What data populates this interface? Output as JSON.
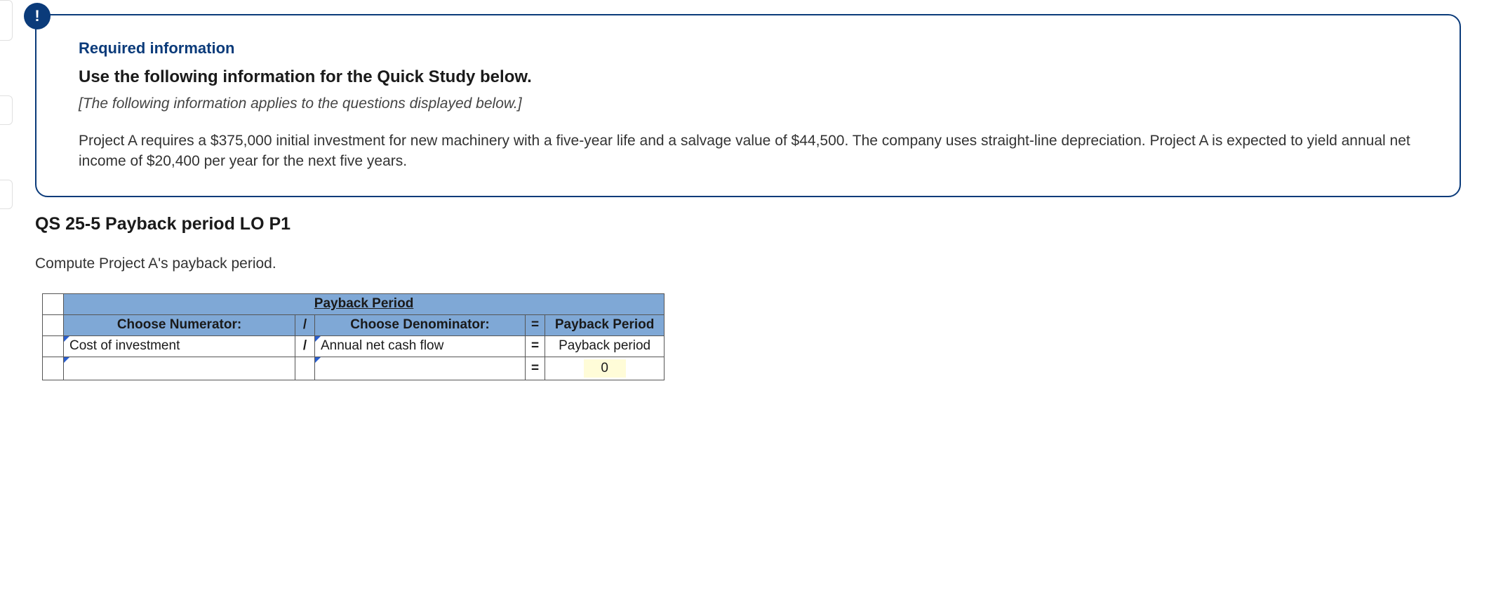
{
  "badge_char": "!",
  "info": {
    "required_header": "Required information",
    "use_heading": "Use the following information for the Quick Study below.",
    "italic_note": "[The following information applies to the questions displayed below.]",
    "prose": "Project A requires a $375,000 initial investment for new machinery with a five-year life and a salvage value of $44,500. The company uses straight-line depreciation. Project A is expected to yield annual net income of $20,400 per year for the next five years."
  },
  "qs_title": "QS 25-5 Payback period LO P1",
  "instruction": "Compute Project A's payback period.",
  "table": {
    "title": "Payback Period",
    "choose_numerator": "Choose Numerator:",
    "choose_denominator": "Choose Denominator:",
    "result_header": "Payback Period",
    "slash": "/",
    "equals": "=",
    "row1": {
      "numerator": "Cost of investment",
      "denominator": "Annual net cash flow",
      "result_label": "Payback period"
    },
    "row2": {
      "numerator": "",
      "denominator": "",
      "result_value": "0"
    }
  }
}
